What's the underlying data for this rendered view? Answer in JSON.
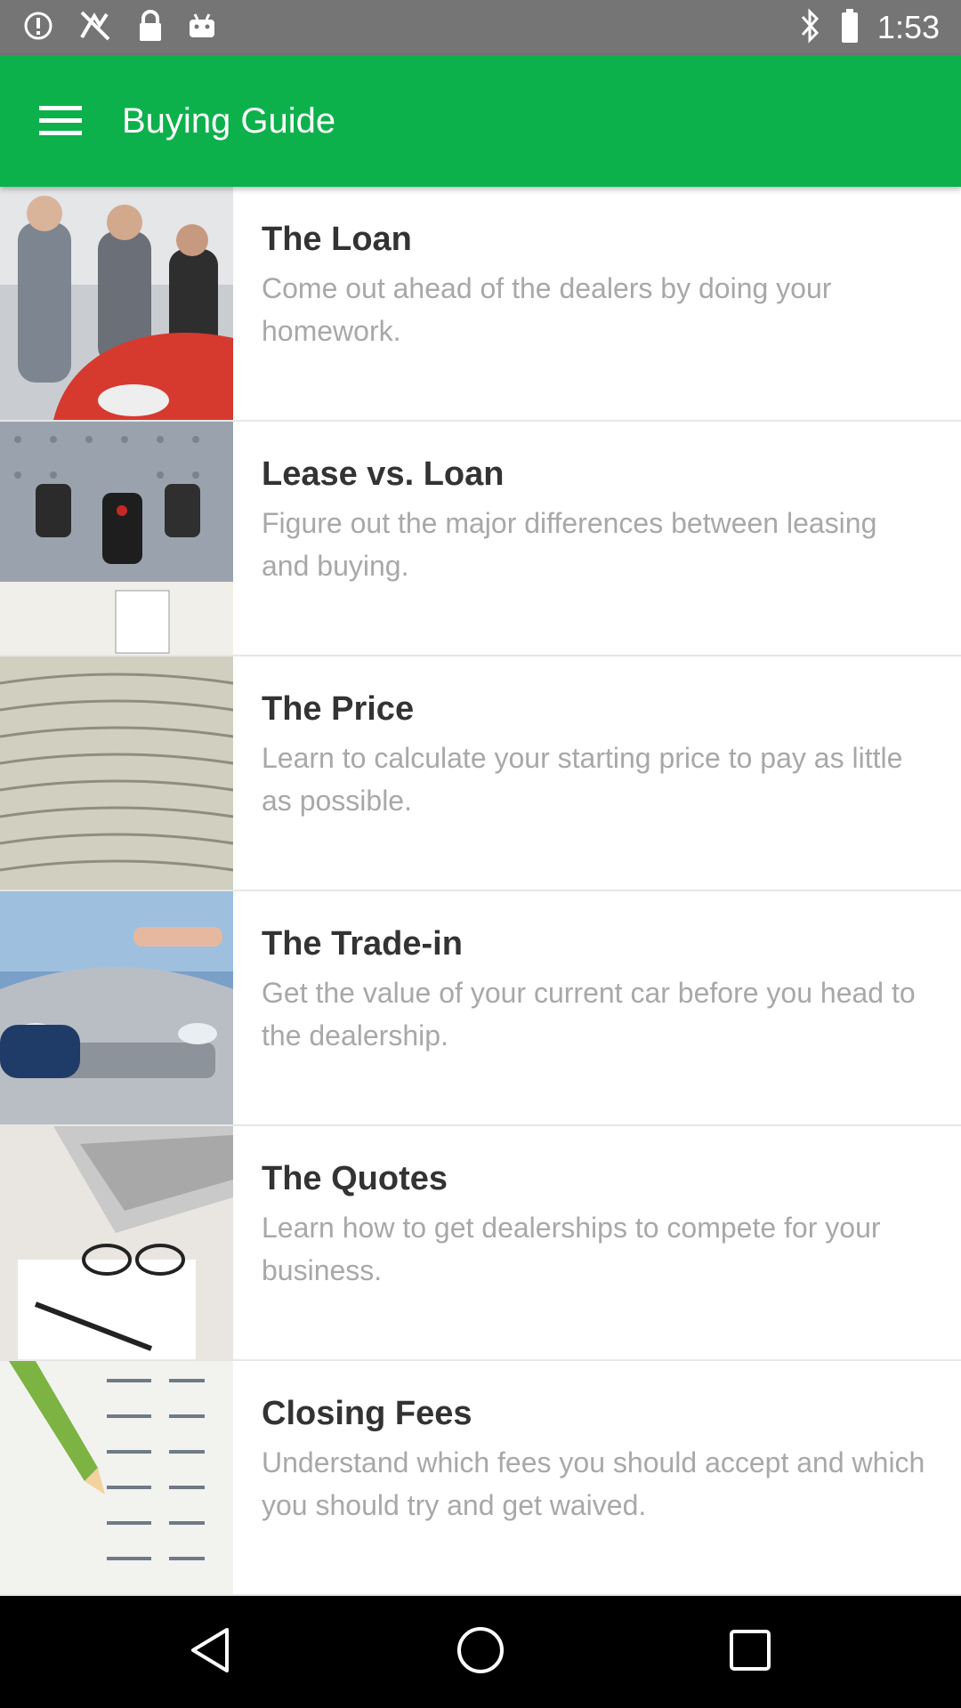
{
  "status_bar": {
    "time": "1:53",
    "left_icons": [
      "alert-circle-icon",
      "no-signal-icon",
      "lock-icon",
      "android-icon"
    ],
    "right_icons": [
      "bluetooth-icon"
    ],
    "background": "#757575"
  },
  "app_bar": {
    "title": "Buying Guide",
    "menu_icon": "hamburger-menu-icon",
    "background": "#0db14b"
  },
  "items": [
    {
      "title": "The Loan",
      "description": "Come out ahead of the dealers by doing your homework.",
      "image": "car-handshake-photo"
    },
    {
      "title": "Lease vs. Loan",
      "description": "Figure out the major differences between leasing and buying.",
      "image": "car-keys-photo"
    },
    {
      "title": "The Price",
      "description": "Learn to calculate your starting price to pay as little as possible.",
      "image": "money-stack-photo"
    },
    {
      "title": "The Trade-in",
      "description": "Get the value of your current car before you head to the dealership.",
      "image": "silver-car-keys-photo"
    },
    {
      "title": "The Quotes",
      "description": "Learn how to get dealerships to compete for your business.",
      "image": "laptop-glasses-photo"
    },
    {
      "title": "Closing Fees",
      "description": "Understand which fees you should accept and which you should try and get waived.",
      "image": "pencil-numbers-photo"
    }
  ],
  "nav_bar": {
    "back_icon": "back-triangle-icon",
    "home_icon": "home-circle-icon",
    "recents_icon": "recents-square-icon"
  }
}
